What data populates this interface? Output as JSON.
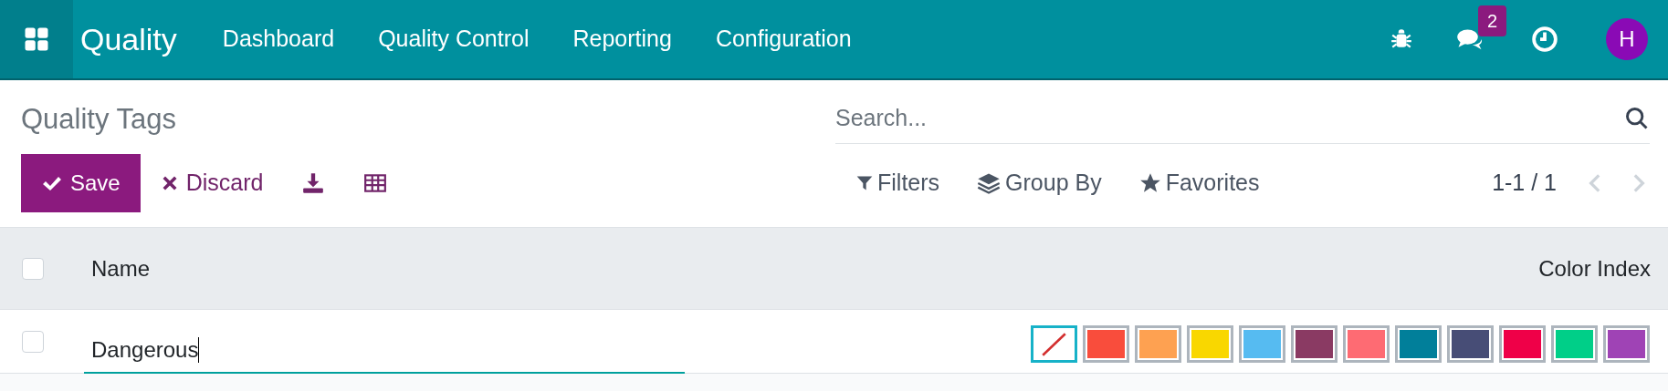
{
  "navbar": {
    "app_name": "Quality",
    "menu": [
      "Dashboard",
      "Quality Control",
      "Reporting",
      "Configuration"
    ],
    "messages_count": "2",
    "avatar_initial": "H"
  },
  "control_panel": {
    "title": "Quality Tags",
    "save_label": "Save",
    "discard_label": "Discard",
    "search": {
      "placeholder": "Search..."
    },
    "filters_label": "Filters",
    "group_by_label": "Group By",
    "favorites_label": "Favorites",
    "pager": "1-1 / 1"
  },
  "table": {
    "columns": [
      "Name",
      "Color Index"
    ],
    "header_checked": false,
    "rows": [
      {
        "checked": false,
        "name": "Dangerous",
        "swatches": [
          {
            "kind": "none",
            "selected": true
          },
          {
            "kind": "color",
            "color": "#f94d3c",
            "selected": false
          },
          {
            "kind": "color",
            "color": "#fea151",
            "selected": false
          },
          {
            "kind": "color",
            "color": "#f9d700",
            "selected": false
          },
          {
            "kind": "color",
            "color": "#56bbf1",
            "selected": false
          },
          {
            "kind": "color",
            "color": "#8a3a63",
            "selected": false
          },
          {
            "kind": "color",
            "color": "#fe6b73",
            "selected": false
          },
          {
            "kind": "color",
            "color": "#017f9a",
            "selected": false
          },
          {
            "kind": "color",
            "color": "#474d76",
            "selected": false
          },
          {
            "kind": "color",
            "color": "#ef0048",
            "selected": false
          },
          {
            "kind": "color",
            "color": "#00cf88",
            "selected": false
          },
          {
            "kind": "color",
            "color": "#9f43b5",
            "selected": false
          }
        ]
      }
    ]
  }
}
